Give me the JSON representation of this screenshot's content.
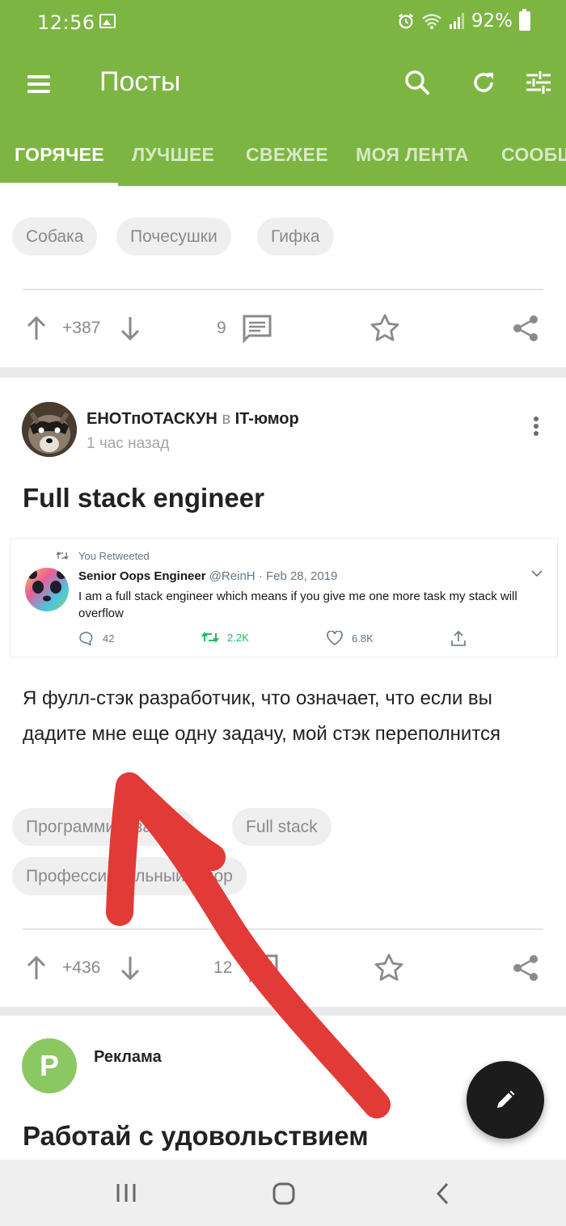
{
  "status_bar": {
    "time": "12:56",
    "battery": "92%"
  },
  "app_bar": {
    "title": "Посты",
    "tabs": [
      {
        "label": "ГОРЯЧЕЕ",
        "active": true
      },
      {
        "label": "ЛУЧШЕЕ",
        "active": false
      },
      {
        "label": "СВЕЖЕЕ",
        "active": false
      },
      {
        "label": "МОЯ ЛЕНТА",
        "active": false
      },
      {
        "label": "СООБЩЕСТВА",
        "active": false
      }
    ]
  },
  "post1": {
    "tags": [
      "Собака",
      "Почесушки",
      "Гифка"
    ],
    "score": "+387",
    "comments": "9"
  },
  "post2": {
    "author": "ЕНОТпОТАСКУН",
    "in_word": "в",
    "community": "IT-юмор",
    "time": "1 час назад",
    "title": "Full stack engineer",
    "tweet": {
      "retweet_label": "You Retweeted",
      "name": "Senior Oops Engineer",
      "meta": "@ReinH · Feb 28, 2019",
      "text": "I am a full stack engineer which means if you give me one more task my stack will overflow",
      "replies": "42",
      "retweets": "2.2K",
      "likes": "6.8K"
    },
    "body": "Я фулл-стэк разработчик, что означает, что если вы дадите мне еще одну задачу, мой стэк переполнится",
    "tags": [
      "Программирование",
      "Full stack",
      "Профессиональный юмор"
    ],
    "score": "+436",
    "comments": "12"
  },
  "ad": {
    "avatar_letter": "P",
    "label": "Реклама",
    "title": "Работай с удовольствием"
  },
  "colors": {
    "brand": "#7db543",
    "annotation_arrow": "#e23a36"
  },
  "icons": [
    "menu-icon",
    "search-icon",
    "refresh-icon",
    "filter-icon",
    "arrow-up-icon",
    "arrow-down-icon",
    "comment-icon",
    "star-icon",
    "share-icon",
    "more-vertical-icon",
    "pencil-icon",
    "recents-icon",
    "home-icon",
    "back-icon"
  ]
}
